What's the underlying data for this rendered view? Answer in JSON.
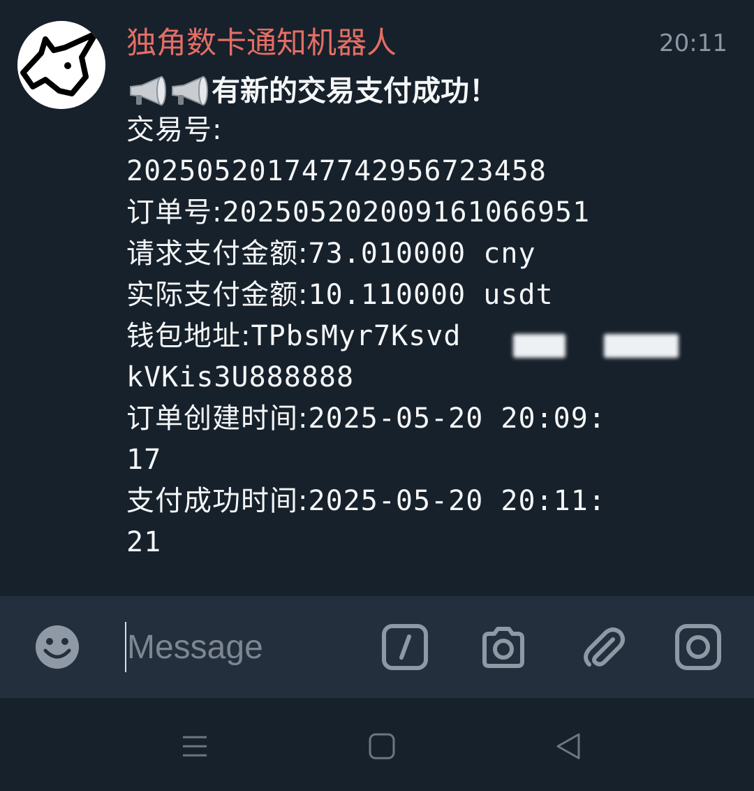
{
  "colors": {
    "chat_bg": "#17212b",
    "input_bar_bg": "#242f3d",
    "sender_name": "#e46e65",
    "text": "#f5f6f7",
    "time": "#8a97a4",
    "icon": "#8e99a5"
  },
  "message": {
    "sender": "独角数卡通知机器人",
    "time": "20:11",
    "headline_icons": [
      "megaphone-icon",
      "megaphone-icon"
    ],
    "headline": "有新的交易支付成功！",
    "lines": [
      {
        "label": "交易号:",
        "value": ""
      },
      {
        "label": "",
        "value": "20250520174774295672345​8"
      },
      {
        "label": "订单号:",
        "value": "2025052020091610669​51"
      },
      {
        "label": "请求支付金额:",
        "value": "73.010000 cny"
      },
      {
        "label": "实际支付金额:",
        "value": "10.110000 usdt"
      },
      {
        "label": "钱包地址:",
        "value": "TPbsMyr7Ksvd"
      },
      {
        "label": "",
        "value": "kVKis3U888888"
      },
      {
        "label": "订单创建时间:",
        "value": "2025-05-20 20:09:"
      },
      {
        "label": "",
        "value": "17"
      },
      {
        "label": "支付成功时间:",
        "value": "2025-05-20 20:11:"
      },
      {
        "label": "",
        "value": "21"
      }
    ]
  },
  "input_bar": {
    "placeholder": "Message",
    "icons": [
      "emoji-icon",
      "bot-command-icon",
      "camera-icon",
      "attach-icon",
      "instagram-icon"
    ]
  },
  "nav": {
    "icons": [
      "menu-icon",
      "home-icon",
      "back-icon"
    ]
  }
}
